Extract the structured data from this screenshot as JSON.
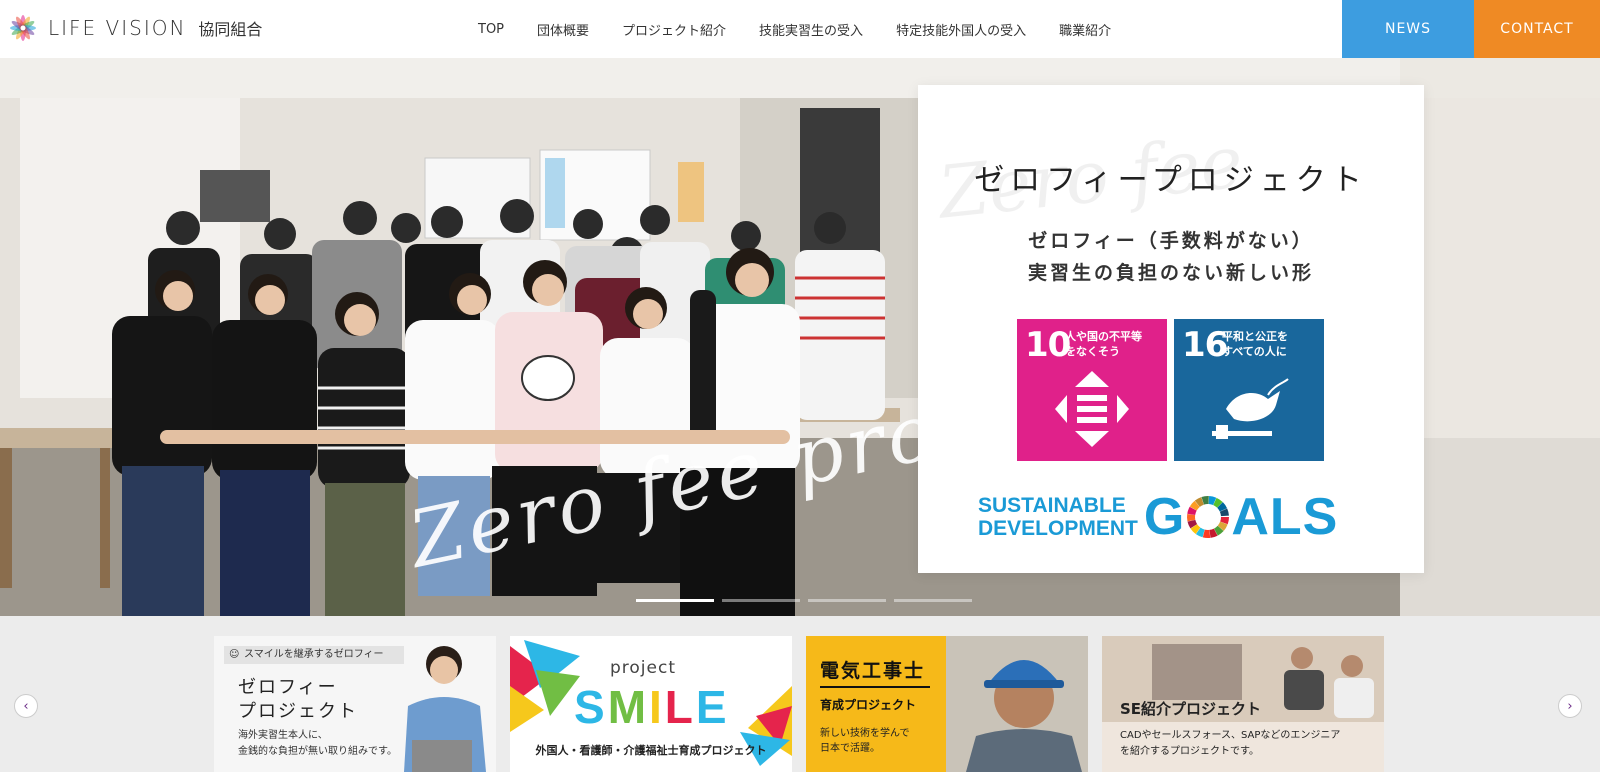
{
  "brand": {
    "name_en": "LIFE VISION",
    "name_jp": "協同組合"
  },
  "nav": {
    "items": [
      {
        "label": "TOP"
      },
      {
        "label": "団体概要"
      },
      {
        "label": "プロジェクト紹介"
      },
      {
        "label": "技能実習生の受入"
      },
      {
        "label": "特定技能外国人の受入"
      },
      {
        "label": "職業紹介"
      }
    ],
    "news_label": "NEWS",
    "contact_label": "CONTACT"
  },
  "hero": {
    "script_text": "Zero fee proj",
    "card": {
      "watermark": "Zero fee",
      "title": "ゼロフィープロジェクト",
      "subtitle_line1": "ゼロフィー（手数料がない）",
      "subtitle_line2": "実習生の負担のない新しい形",
      "sdg10": {
        "number": "10",
        "label_line1": "人や国の不平等",
        "label_line2": "をなくそう"
      },
      "sdg16": {
        "number": "16",
        "label_line1": "平和と公正を",
        "label_line2": "すべての人に"
      },
      "sdg_brand_line1": "SUSTAINABLE",
      "sdg_brand_line2": "DEVELOPMENT",
      "sdg_goals_g": "G",
      "sdg_goals_als": "ALS"
    },
    "slides_total": 4,
    "active_slide": 1
  },
  "carousel": {
    "prev_icon": "chevron-left-icon",
    "next_icon": "chevron-right-icon",
    "cards": [
      {
        "tag": "スマイルを継承するゼロフィー",
        "title_line1": "ゼロフィー",
        "title_line2": "プロジェクト",
        "text_line1": "海外実習生本人に、",
        "text_line2": "金銭的な負担が無い取り組みです。"
      },
      {
        "project": "project",
        "smile": "SMILE",
        "text": "外国人・看護師・介護福祉士育成プロジェクト"
      },
      {
        "title": "電気工事士",
        "subtitle": "育成プロジェクト",
        "text_line1": "新しい技術を学んで",
        "text_line2": "日本で活躍。"
      },
      {
        "title": "SE紹介プロジェクト",
        "text_line1": "CADやセールスフォース、SAPなどのエンジニア",
        "text_line2": "を紹介するプロジェクトです。"
      }
    ]
  },
  "colors": {
    "news": "#3d9de0",
    "contact": "#ef8a24",
    "sdg10": "#e0218a",
    "sdg16": "#19679c",
    "sdg_brand": "#1a9ad6",
    "electric_yellow": "#f6b919"
  }
}
